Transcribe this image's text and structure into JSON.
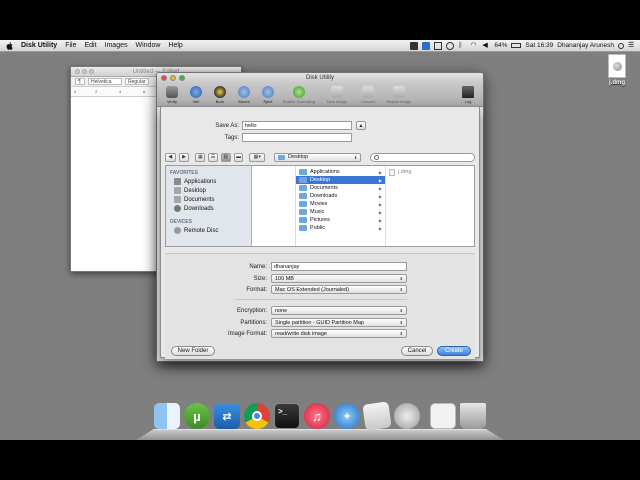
{
  "menubar": {
    "app_name": "Disk Utility",
    "items": [
      "File",
      "Edit",
      "Images",
      "Window",
      "Help"
    ],
    "battery": "64%",
    "clock": "Sat 16:39",
    "user": "Dhananjay Arunesh"
  },
  "desktop": {
    "file_label": "j.dmg"
  },
  "textedit": {
    "title": "Untitled — Edited",
    "font": "Helvetica",
    "style": "Regular",
    "ruler_ticks": [
      "0",
      "2",
      "4",
      "6"
    ]
  },
  "disk_utility": {
    "title": "Disk Utility",
    "tools": [
      {
        "label": "Verify",
        "icon": "microscope-icon"
      },
      {
        "label": "Info",
        "icon": "info-icon"
      },
      {
        "label": "Burn",
        "icon": "burn-icon"
      },
      {
        "label": "Mount",
        "icon": "mount-icon"
      },
      {
        "label": "Eject",
        "icon": "eject-icon"
      },
      {
        "label": "Enable Journaling",
        "icon": "journaling-icon"
      },
      {
        "label": "New Image",
        "icon": "new-image-icon"
      },
      {
        "label": "Convert",
        "icon": "convert-icon"
      },
      {
        "label": "Resize Image",
        "icon": "resize-icon"
      }
    ],
    "log_label": "Log"
  },
  "sheet": {
    "save_as_label": "Save As:",
    "save_as_value": "hello",
    "tags_label": "Tags:",
    "tags_value": "",
    "location": "Desktop",
    "search_placeholder": "",
    "sidebar": {
      "favorites_header": "FAVORITES",
      "favorites": [
        "Applications",
        "Desktop",
        "Documents",
        "Downloads"
      ],
      "devices_header": "DEVICES",
      "devices": [
        "Remote Disc"
      ]
    },
    "folders": [
      "Applications",
      "Desktop",
      "Documents",
      "Downloads",
      "Movies",
      "Music",
      "Pictures",
      "Public"
    ],
    "selected_folder": "Desktop",
    "desktop_contents": [
      "j.dmg"
    ],
    "options": {
      "name_label": "Name:",
      "name_value": "dhananjay",
      "size_label": "Size:",
      "size_value": "100 MB",
      "format_label": "Format:",
      "format_value": "Mac OS Extended (Journaled)",
      "encryption_label": "Encryption:",
      "encryption_value": "none",
      "partitions_label": "Partitions:",
      "partitions_value": "Single partition - GUID Partition Map",
      "image_format_label": "Image Format:",
      "image_format_value": "read/write disk image"
    },
    "new_folder_label": "New Folder",
    "cancel_label": "Cancel",
    "create_label": "Create"
  },
  "colors": {
    "selection_blue": "#3a76d6",
    "desktop_gray": "#7f7f7f",
    "primary_button": "#3c83dc"
  }
}
